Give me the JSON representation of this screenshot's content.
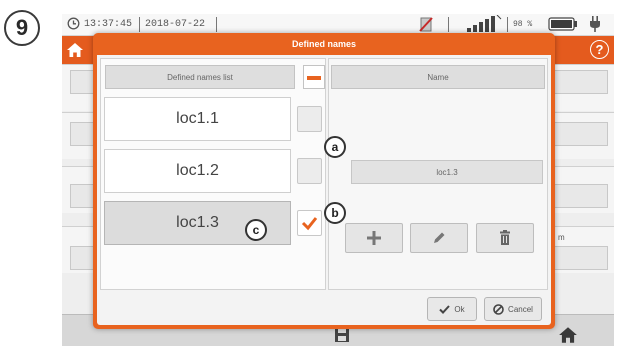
{
  "step": "9",
  "status": {
    "time": "13:37:45",
    "date": "2018-07-22",
    "battery_percent": "98 %"
  },
  "colors": {
    "accent": "#e45b1e",
    "dialog_border": "#e8631f"
  },
  "background": {
    "right_fragment": "m"
  },
  "dialog": {
    "title": "Defined names",
    "list_header": "Defined names list",
    "name_header": "Name",
    "items": [
      "loc1.1",
      "loc1.2",
      "loc1.3"
    ],
    "selected_item": "loc1.3",
    "name_value": "loc1.3",
    "ok_label": "Ok",
    "cancel_label": "Cancel"
  },
  "callouts": {
    "a": "a",
    "b": "b",
    "c": "c"
  },
  "icons": [
    "clock-icon",
    "home-icon",
    "help-icon",
    "check-icon",
    "plus-icon",
    "pencil-icon",
    "trash-icon",
    "cancel-icon",
    "save-icon",
    "signal-icon",
    "battery-icon",
    "plug-icon"
  ]
}
